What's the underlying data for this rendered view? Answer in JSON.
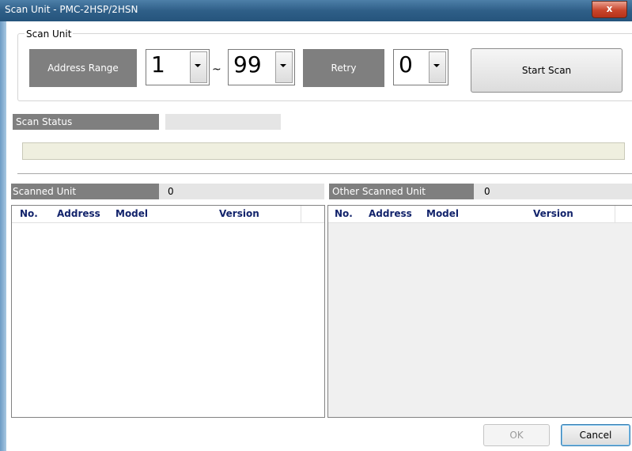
{
  "window": {
    "title": "Scan Unit  - PMC-2HSP/2HSN",
    "close_label": "x"
  },
  "scan_unit": {
    "legend": "Scan Unit",
    "address_range_label": "Address Range",
    "range_from": "1",
    "range_separator": "~",
    "range_to": "99",
    "retry_label": "Retry",
    "retry_value": "0",
    "start_scan_label": "Start Scan"
  },
  "scan_status": {
    "label": "Scan Status",
    "value": ""
  },
  "scanned_unit": {
    "label": "Scanned Unit",
    "count": "0",
    "columns": [
      "No.",
      "Address",
      "Model",
      "Version"
    ],
    "rows": []
  },
  "other_scanned_unit": {
    "label": "Other Scanned Unit",
    "count": "0",
    "columns": [
      "No.",
      "Address",
      "Model",
      "Version"
    ],
    "rows": []
  },
  "footer": {
    "ok_label": "OK",
    "cancel_label": "Cancel"
  },
  "colors": {
    "label_bg": "#7f7f7f",
    "header_text": "#12236b",
    "progress_bg": "#efefdf"
  }
}
